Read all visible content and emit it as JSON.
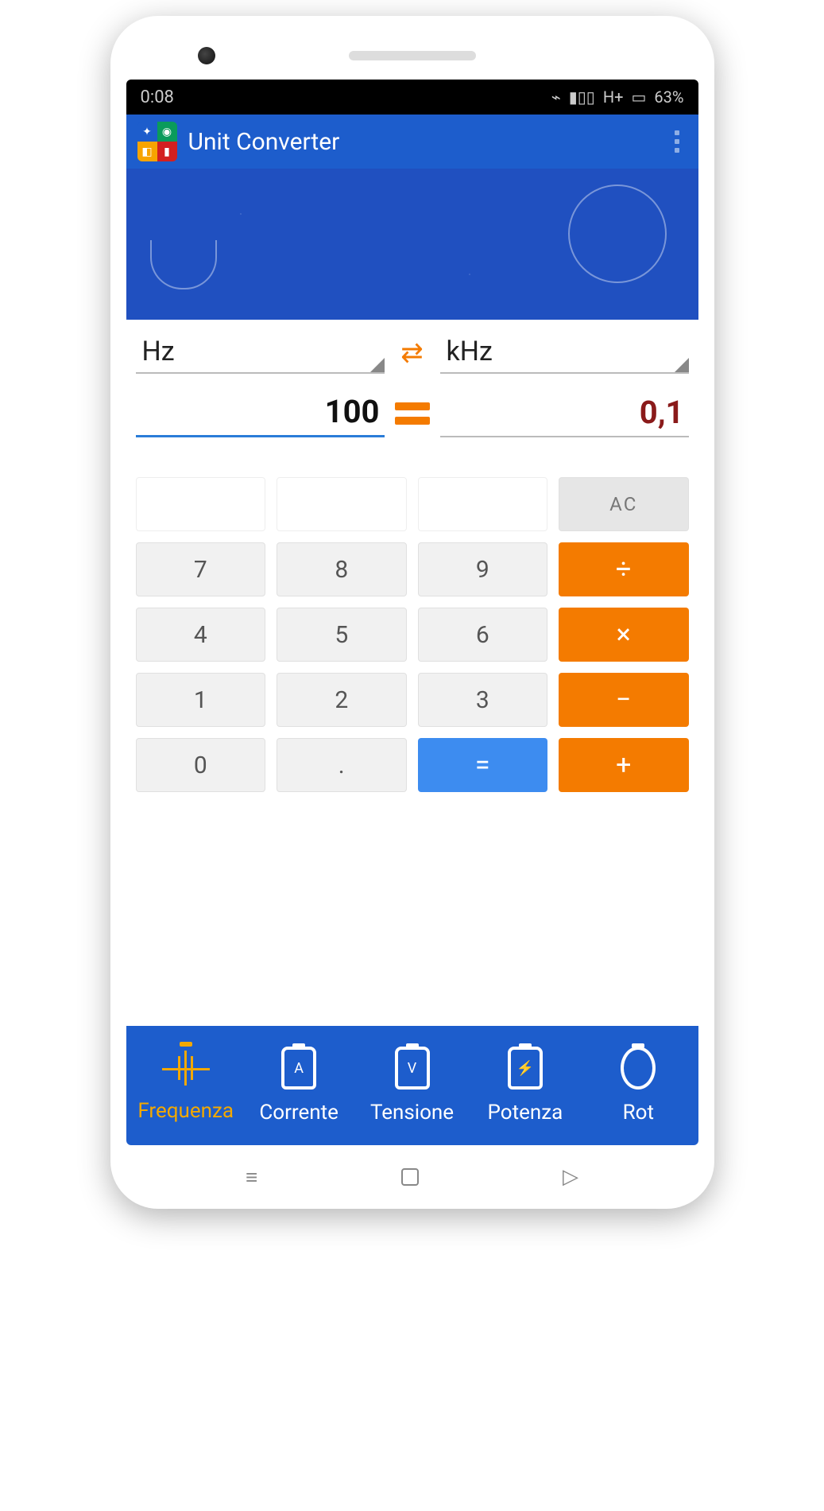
{
  "status": {
    "time": "0:08",
    "network": "H+",
    "battery": "63%"
  },
  "app": {
    "title": "Unit Converter"
  },
  "converter": {
    "from_unit": "Hz",
    "to_unit": "kHz",
    "input_value": "100",
    "output_value": "0,1"
  },
  "keypad": {
    "ac": "AC",
    "k7": "7",
    "k8": "8",
    "k9": "9",
    "div": "÷",
    "k4": "4",
    "k5": "5",
    "k6": "6",
    "mul": "×",
    "k1": "1",
    "k2": "2",
    "k3": "3",
    "sub": "−",
    "k0": "0",
    "dot": ".",
    "eq": "=",
    "add": "+"
  },
  "nav": {
    "items": [
      {
        "label": "Frequenza",
        "glyph": ""
      },
      {
        "label": "Corrente",
        "glyph": "A"
      },
      {
        "label": "Tensione",
        "glyph": "V"
      },
      {
        "label": "Potenza",
        "glyph": "⚡"
      },
      {
        "label": "Rot",
        "glyph": ""
      }
    ]
  }
}
